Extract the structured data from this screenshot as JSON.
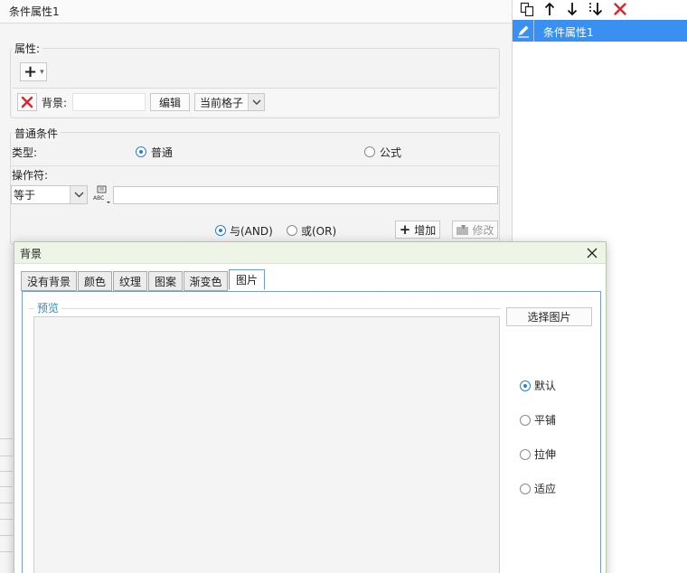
{
  "left_panel": {
    "title": "条件属性1",
    "attributes_section": {
      "legend": "属性:",
      "add_symbol": "+",
      "dropdown_arrow": "▾",
      "background_label": "背景:",
      "background_value": "",
      "edit_label": "编辑",
      "scope_select": "当前格子"
    },
    "condition_section": {
      "legend": "普通条件",
      "type_label": "类型:",
      "type_options": [
        {
          "label": "普通",
          "selected": true
        },
        {
          "label": "公式",
          "selected": false
        }
      ],
      "operator_label": "操作符:",
      "operator_value": "等于",
      "operand_value": "",
      "logic_options": [
        {
          "label": "与(AND)",
          "selected": true
        },
        {
          "label": "或(OR)",
          "selected": false
        }
      ],
      "add_button": "增加",
      "modify_button": "修改"
    }
  },
  "right_panel": {
    "toolbar_icons": [
      "copy-icon",
      "arrow-up-icon",
      "arrow-down-icon",
      "move-bottom-icon",
      "delete-icon"
    ],
    "items": [
      {
        "label": "条件属性1",
        "selected": true
      }
    ]
  },
  "dialog": {
    "title": "背景",
    "tabs": [
      {
        "label": "没有背景",
        "active": false
      },
      {
        "label": "颜色",
        "active": false
      },
      {
        "label": "纹理",
        "active": false
      },
      {
        "label": "图案",
        "active": false
      },
      {
        "label": "渐变色",
        "active": false
      },
      {
        "label": "图片",
        "active": true
      }
    ],
    "preview_label": "预览",
    "select_image_button": "选择图片",
    "layout_options": [
      {
        "label": "默认",
        "selected": true
      },
      {
        "label": "平铺",
        "selected": false
      },
      {
        "label": "拉伸",
        "selected": false
      },
      {
        "label": "适应",
        "selected": false
      }
    ]
  },
  "colors": {
    "accent": "#3a90f0",
    "delete_red": "#d9262c",
    "dialog_header": "#eef5e6",
    "preview_label": "#2a8fc0"
  }
}
